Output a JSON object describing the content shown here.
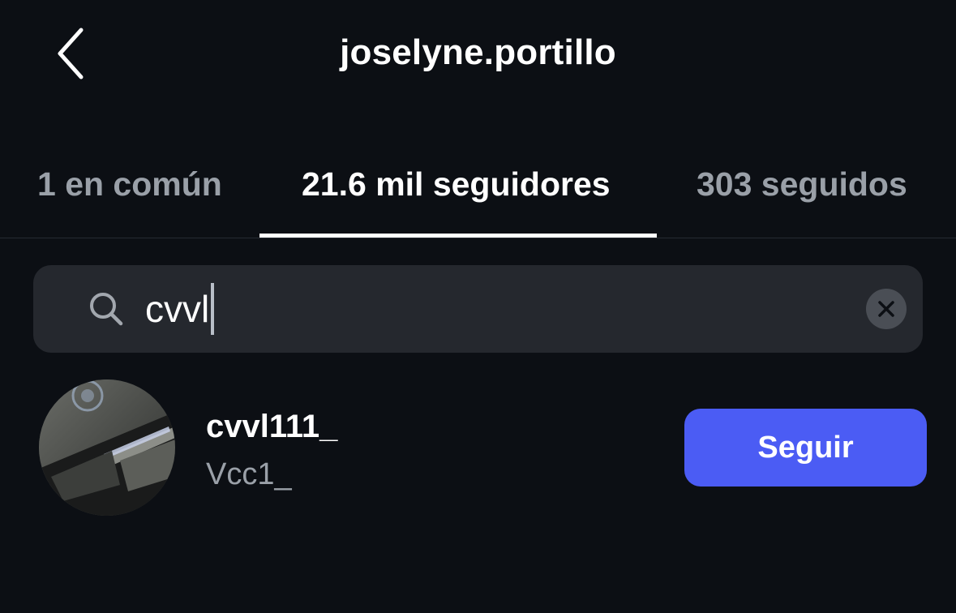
{
  "header": {
    "title": "joselyne.portillo",
    "back_icon": "chevron-left-icon"
  },
  "tabs": [
    {
      "label": "1 en común",
      "active": false
    },
    {
      "label": "21.6 mil seguidores",
      "active": true
    },
    {
      "label": "303 seguidos",
      "active": false
    }
  ],
  "search": {
    "value": "cvvl",
    "search_icon": "search-icon",
    "clear_icon": "clear-icon"
  },
  "results": [
    {
      "username": "cvvl111_",
      "full_name": "Vcc1_",
      "button_label": "Seguir"
    }
  ],
  "colors": {
    "background": "#0c0f14",
    "search_bg": "#25282e",
    "button_bg": "#4b5cf4",
    "inactive_tab": "#9aa0a8"
  }
}
